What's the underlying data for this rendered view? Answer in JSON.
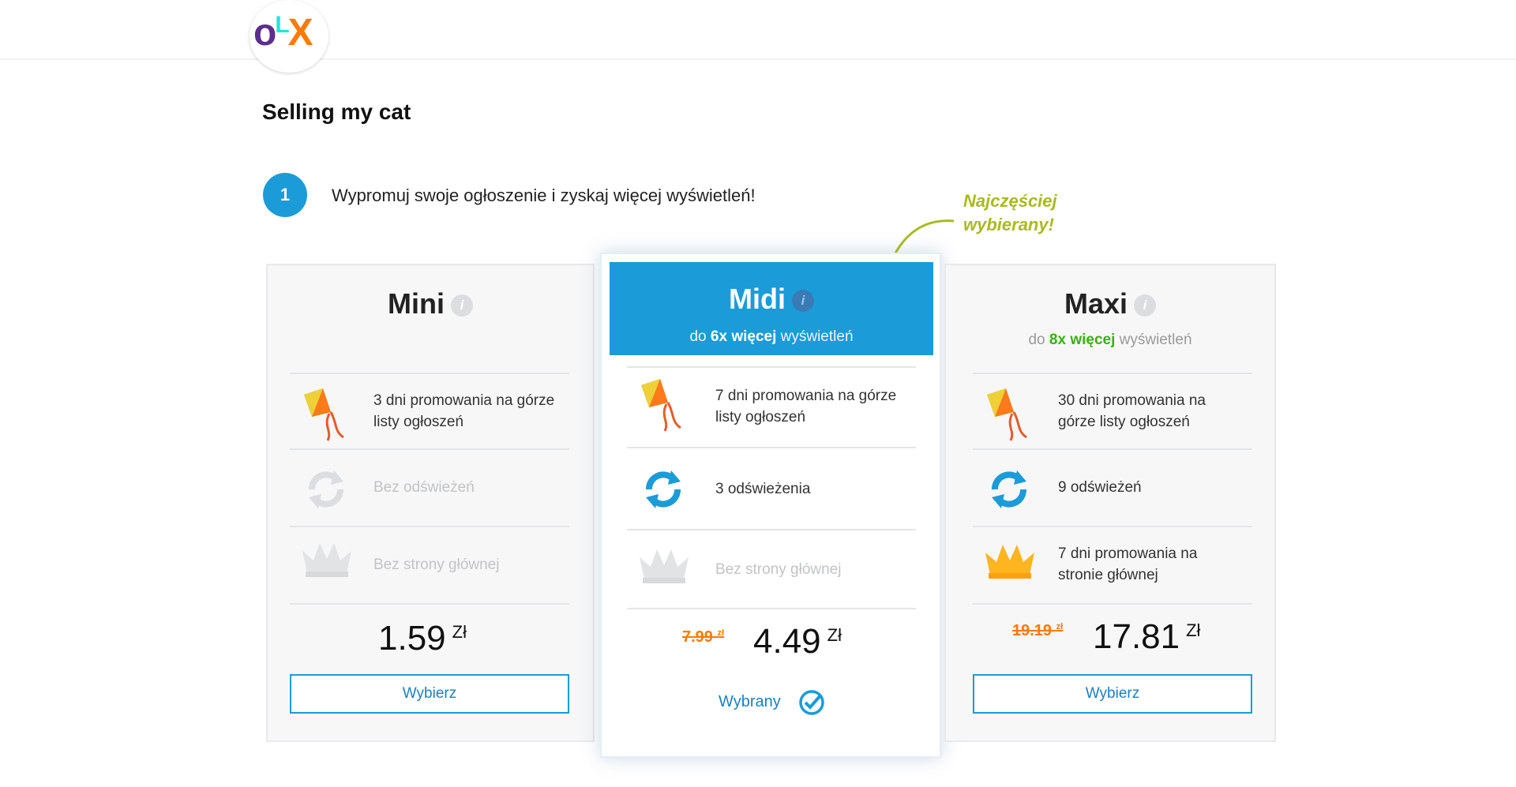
{
  "logo": {
    "text_o": "o",
    "text_l": "L",
    "text_x": "X"
  },
  "page_title": "Selling my cat",
  "step": {
    "number": "1",
    "text": "Wypromuj swoje ogłoszenie i zyskaj więcej wyświetleń!"
  },
  "popular_note": {
    "line1": "Najczęściej",
    "line2": "wybierany!"
  },
  "colors": {
    "accent": "#1b9bd8",
    "highlight": "#a9ba1f",
    "old_price": "#ff7a00",
    "green": "#3cb013"
  },
  "plans": {
    "mini": {
      "name": "Mini",
      "info_icon": "i",
      "features": [
        {
          "icon": "kite-icon",
          "text": "3 dni promowania na górze listy ogłoszeń",
          "enabled": true
        },
        {
          "icon": "refresh-icon",
          "text": "Bez odświeżeń",
          "enabled": false
        },
        {
          "icon": "crown-icon",
          "text": "Bez strony głównej",
          "enabled": false
        }
      ],
      "price": "1.59",
      "currency": "Zł",
      "button": "Wybierz"
    },
    "midi": {
      "name": "Midi",
      "info_icon": "i",
      "sub_prefix": "do",
      "sub_bold": "6x więcej",
      "sub_suffix": "wyświetleń",
      "features": [
        {
          "icon": "kite-icon",
          "text": "7 dni promowania na górze listy ogłoszeń",
          "enabled": true
        },
        {
          "icon": "refresh-icon",
          "text": "3 odświeżenia",
          "enabled": true
        },
        {
          "icon": "crown-icon",
          "text": "Bez strony głównej",
          "enabled": false
        }
      ],
      "old_price": "7.99",
      "old_currency": "zł",
      "price": "4.49",
      "currency": "Zł",
      "chosen_label": "Wybrany"
    },
    "maxi": {
      "name": "Maxi",
      "info_icon": "i",
      "sub_prefix": "do",
      "sub_bold": "8x więcej",
      "sub_suffix": "wyświetleń",
      "features": [
        {
          "icon": "kite-icon",
          "text": "30 dni promowania na górze listy ogłoszeń",
          "enabled": true
        },
        {
          "icon": "refresh-icon",
          "text": "9 odświeżeń",
          "enabled": true
        },
        {
          "icon": "crown-icon",
          "text": "7 dni promowania na stronie głównej",
          "enabled": true
        }
      ],
      "old_price": "19.19",
      "old_currency": "zł",
      "price": "17.81",
      "currency": "Zł",
      "button": "Wybierz"
    }
  }
}
